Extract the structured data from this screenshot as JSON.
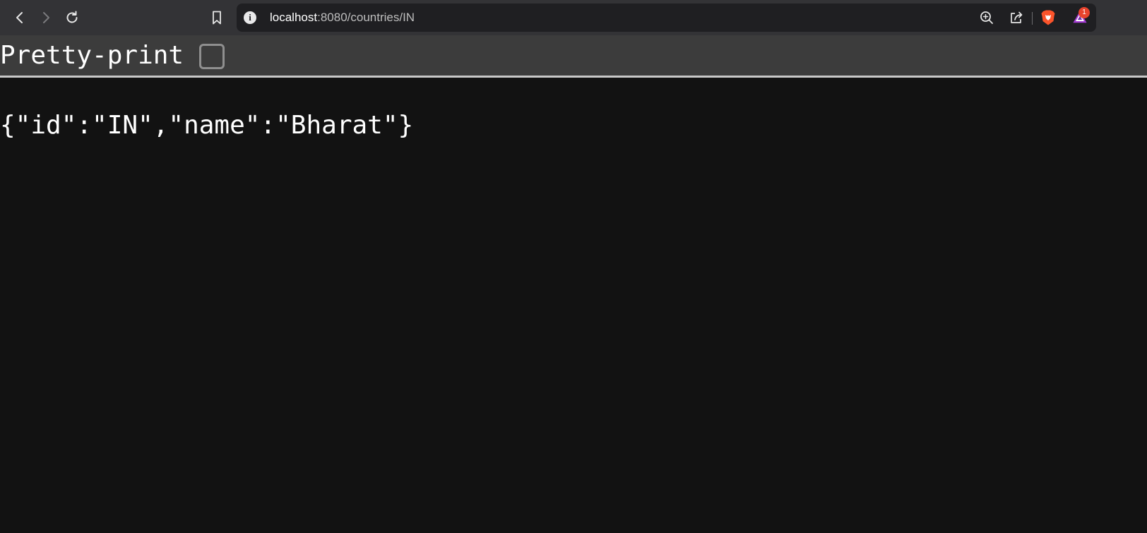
{
  "browser": {
    "url_host": "localhost",
    "url_path": ":8080/countries/IN",
    "notification_count": "1",
    "icons": {
      "back": "back-arrow-icon",
      "forward": "forward-arrow-icon",
      "reload": "reload-icon",
      "bookmark": "bookmark-icon",
      "site_info": "info-icon",
      "zoom": "zoom-icon",
      "share": "share-icon",
      "brave_shields": "brave-lion-icon",
      "brave_rewards": "brave-rewards-triangle-icon"
    }
  },
  "viewer": {
    "pretty_print_label": "Pretty-print",
    "pretty_print_checked": false,
    "json_text": "{\"id\":\"IN\",\"name\":\"Bharat\"}"
  },
  "colors": {
    "toolbar_bg": "#333336",
    "omnibox_bg": "#1f1f22",
    "page_bg": "#121212",
    "pretty_bar_bg": "#3c3c3c",
    "brave_orange": "#fb542b",
    "badge_red": "#e8432d"
  }
}
